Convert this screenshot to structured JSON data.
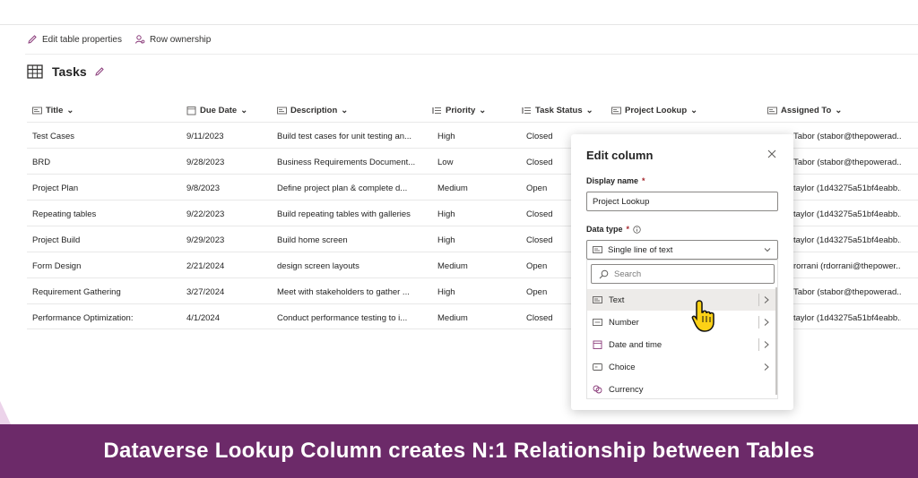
{
  "command_bar": {
    "edit_table_properties": "Edit table properties",
    "row_ownership": "Row ownership"
  },
  "table": {
    "name": "Tasks",
    "columns": [
      "Title",
      "Due Date",
      "Description",
      "Priority",
      "Task Status",
      "Project Lookup",
      "Assigned To"
    ],
    "rows": [
      [
        "Test Cases",
        "9/11/2023",
        "Build test cases for unit testing an...",
        "High",
        "Closed",
        "Tabor (stabor@thepowerad..."
      ],
      [
        "BRD",
        "9/28/2023",
        "Business Requirements Document...",
        "Low",
        "Closed",
        "Tabor (stabor@thepowerad..."
      ],
      [
        "Project Plan",
        "9/8/2023",
        "Define project plan & complete d...",
        "Medium",
        "Open",
        "taylor (1d43275a51bf4eabb..."
      ],
      [
        "Repeating tables",
        "9/22/2023",
        "Build repeating tables with galleries",
        "High",
        "Closed",
        "taylor (1d43275a51bf4eabb..."
      ],
      [
        "Project Build",
        "9/29/2023",
        "Build home screen",
        "High",
        "Closed",
        "taylor (1d43275a51bf4eabb..."
      ],
      [
        "Form Design",
        "2/21/2024",
        "design screen layouts",
        "Medium",
        "Open",
        "rorrani (rdorrani@thepower..."
      ],
      [
        "Requirement Gathering",
        "3/27/2024",
        "Meet with stakeholders to gather ...",
        "High",
        "Open",
        "Tabor (stabor@thepowerad..."
      ],
      [
        "Performance Optimization:",
        "4/1/2024",
        "Conduct performance testing to i...",
        "Medium",
        "Closed",
        "taylor (1d43275a51bf4eabb..."
      ]
    ]
  },
  "edit_panel": {
    "title": "Edit column",
    "display_name_label": "Display name",
    "display_name_value": "Project Lookup",
    "data_type_label": "Data type",
    "required_mark": "*",
    "data_type_value": "Single line of text",
    "search_placeholder": "Search",
    "options": [
      {
        "label": "Text",
        "icon": "text-icon",
        "submenu": true,
        "selected": true
      },
      {
        "label": "Number",
        "icon": "number-icon",
        "submenu": true,
        "selected": false
      },
      {
        "label": "Date and time",
        "icon": "calendar-icon",
        "submenu": true,
        "selected": false
      },
      {
        "label": "Choice",
        "icon": "choice-icon",
        "submenu": true,
        "selected": false
      },
      {
        "label": "Currency",
        "icon": "currency-icon",
        "submenu": false,
        "selected": false
      }
    ]
  },
  "banner": {
    "text": "Dataverse Lookup Column creates N:1 Relationship between Tables"
  },
  "colors": {
    "banner": "#6c2a69",
    "accent_icon": "#8a3b7a",
    "selected_option": "#edebe9"
  }
}
